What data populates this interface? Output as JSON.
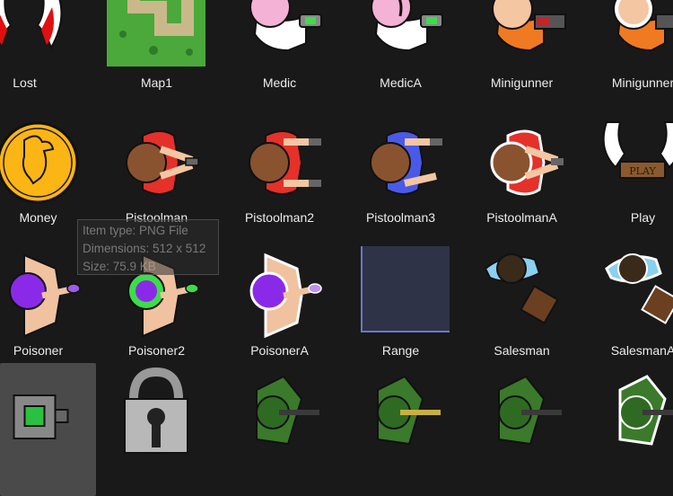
{
  "files": [
    {
      "name": "Lost",
      "icon": "wings-icon"
    },
    {
      "name": "Map1",
      "icon": "map-icon"
    },
    {
      "name": "Medic",
      "icon": "medic-icon"
    },
    {
      "name": "MedicA",
      "icon": "medic-icon"
    },
    {
      "name": "Minigunner",
      "icon": "minigunner-icon"
    },
    {
      "name": "Minigunner",
      "icon": "minigunner-icon"
    },
    {
      "name": "Money",
      "icon": "coin-icon"
    },
    {
      "name": "Pistoolman",
      "icon": "pistolman-icon"
    },
    {
      "name": "Pistoolman2",
      "icon": "pistolman-icon"
    },
    {
      "name": "Pistoolman3",
      "icon": "pistolman-icon"
    },
    {
      "name": "PistoolmanA",
      "icon": "pistolman-icon"
    },
    {
      "name": "Play",
      "icon": "play-sign-icon"
    },
    {
      "name": "Poisoner",
      "icon": "poisoner-icon"
    },
    {
      "name": "Poisoner2",
      "icon": "poisoner-icon"
    },
    {
      "name": "PoisonerA",
      "icon": "poisoner-icon"
    },
    {
      "name": "Range",
      "icon": "range-square-icon"
    },
    {
      "name": "Salesman",
      "icon": "salesman-icon"
    },
    {
      "name": "SalesmanA",
      "icon": "salesman-icon"
    },
    {
      "name": "",
      "icon": "turret-icon"
    },
    {
      "name": "",
      "icon": "padlock-icon"
    },
    {
      "name": "",
      "icon": "camo-soldier-icon"
    },
    {
      "name": "",
      "icon": "camo-soldier-icon"
    },
    {
      "name": "",
      "icon": "camo-soldier-icon"
    },
    {
      "name": "",
      "icon": "camo-soldier-icon"
    }
  ],
  "tooltip": {
    "type": "Item type: PNG File",
    "dimensions": "Dimensions: 512 x 512",
    "size": "Size: 75.9 KB"
  }
}
